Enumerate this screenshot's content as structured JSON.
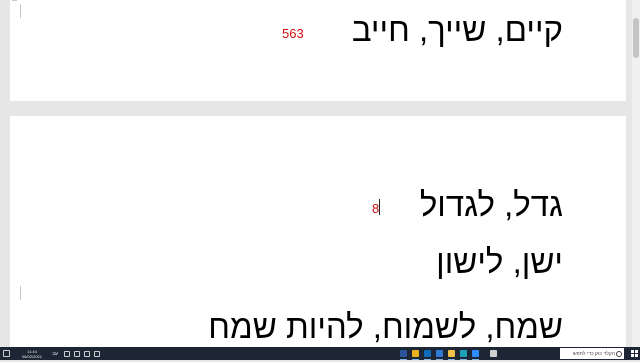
{
  "document": {
    "lines": [
      {
        "text": "קיים, שייך, חייב",
        "number": "563"
      },
      {
        "text": "גדל, לגדול",
        "number": "8"
      },
      {
        "text": "ישן, לישון"
      },
      {
        "text": "שמח, לשמוח, להיות שמח"
      }
    ]
  },
  "taskbar": {
    "clock_time": "11:44",
    "clock_date": "06/02/2021",
    "language": "עב",
    "search_placeholder": "הקלד כאן כדי לחפש",
    "pinned_icons": [
      {
        "name": "word-icon",
        "color": "#2b579a"
      },
      {
        "name": "chrome-icon",
        "color": "#e8b21c"
      },
      {
        "name": "mail-icon",
        "color": "#0f6cbd"
      },
      {
        "name": "store-icon",
        "color": "#2f7bd6"
      },
      {
        "name": "file-explorer-icon",
        "color": "#f0c14b"
      },
      {
        "name": "edge-icon",
        "color": "#1da1b8"
      },
      {
        "name": "zoom-icon",
        "color": "#2d8cff"
      },
      {
        "name": "task-view-icon",
        "color": "#d0d0d0"
      }
    ],
    "tray_icons": [
      {
        "name": "volume-icon",
        "color": "#cfcfcf"
      },
      {
        "name": "network-icon",
        "color": "#cfcfcf"
      },
      {
        "name": "battery-icon",
        "color": "#cfcfcf"
      },
      {
        "name": "chevron-up-icon",
        "color": "#cfcfcf"
      }
    ]
  }
}
